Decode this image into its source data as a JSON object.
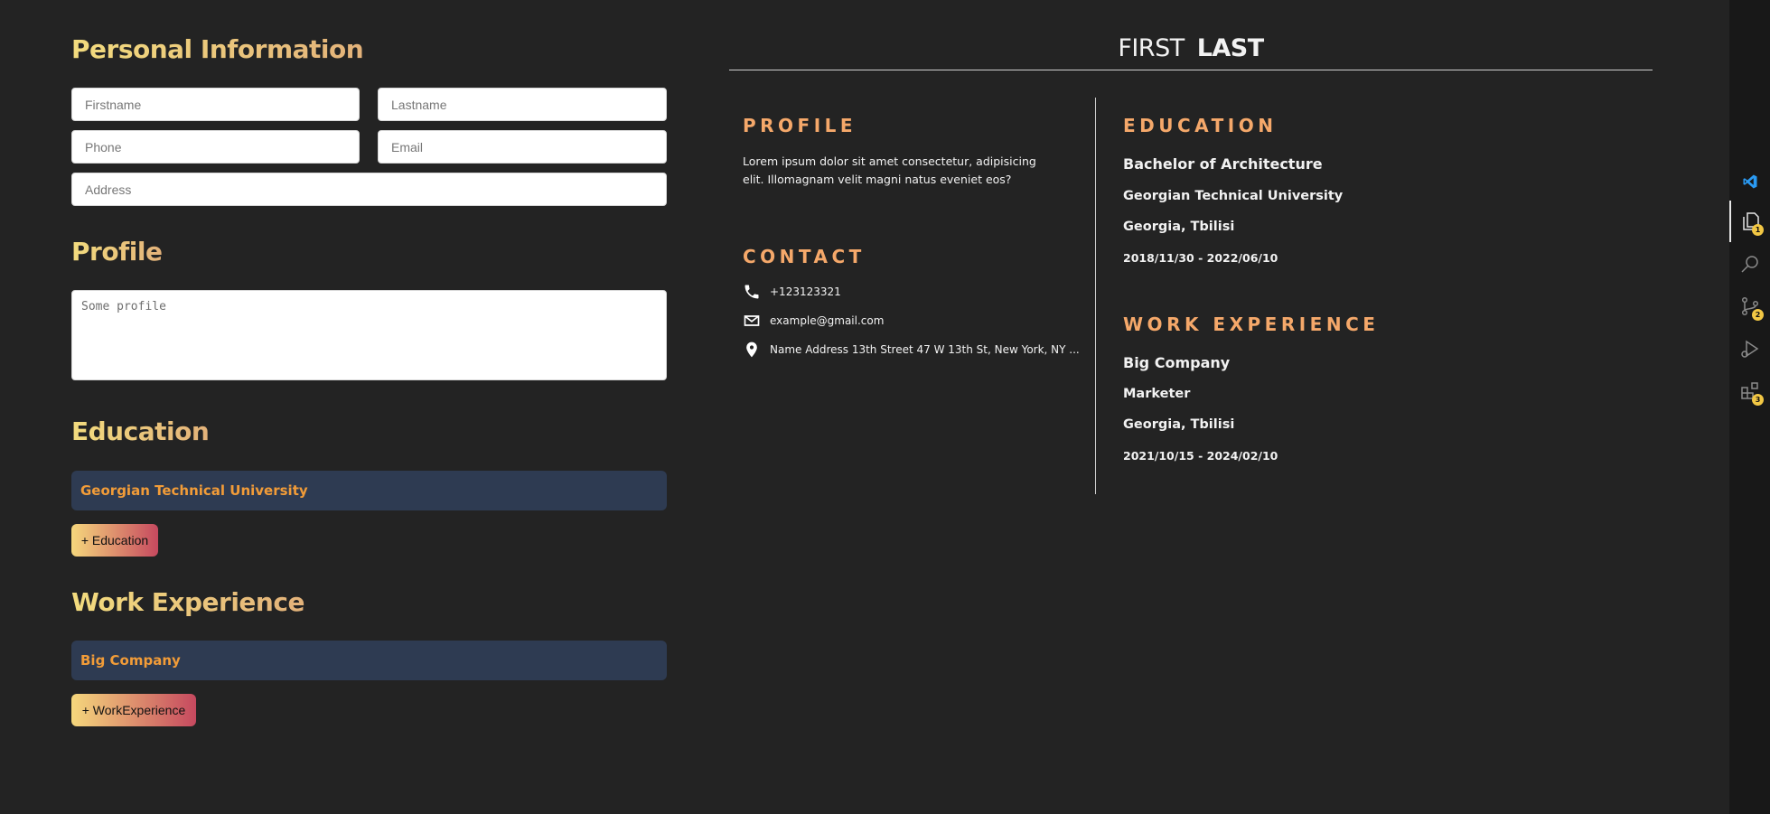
{
  "form": {
    "personal_title": "Personal Information",
    "firstname_placeholder": "Firstname",
    "lastname_placeholder": "Lastname",
    "phone_placeholder": "Phone",
    "email_placeholder": "Email",
    "address_placeholder": "Address",
    "profile_title": "Profile",
    "profile_placeholder": "Some profile",
    "education_title": "Education",
    "education_entries": [
      "Georgian Technical University"
    ],
    "add_education_label": "+ Education",
    "work_title": "Work Experience",
    "work_entries": [
      "Big Company"
    ],
    "add_work_label": "+ WorkExperience"
  },
  "resume": {
    "first_name": "FIRST",
    "last_name": "LAST",
    "profile_heading": "PROFILE",
    "profile_text": "Lorem ipsum dolor sit amet consectetur, adipisicing elit. Illomagnam velit magni natus eveniet eos?",
    "contact_heading": "CONTACT",
    "phone": "+123123321",
    "email": "example@gmail.com",
    "address": "Name Address 13th Street 47 W 13th St, New York, NY ...",
    "education_heading": "EDUCATION",
    "education": {
      "degree": "Bachelor of Architecture",
      "school": "Georgian Technical University",
      "location": "Georgia, Tbilisi",
      "start": "2018/11/30",
      "end": "2022/06/10"
    },
    "work_heading": "WORK EXPERIENCE",
    "work": {
      "company": "Big Company",
      "position": "Marketer",
      "location": "Georgia, Tbilisi",
      "start": "2021/10/15",
      "end": "2024/02/10"
    },
    "date_separator": "-"
  },
  "activity_bar": {
    "items": [
      {
        "icon": "explorer-icon",
        "badge": "1"
      },
      {
        "icon": "search-icon",
        "badge": ""
      },
      {
        "icon": "source-control-icon",
        "badge": "2"
      },
      {
        "icon": "run-debug-icon",
        "badge": ""
      },
      {
        "icon": "extensions-icon",
        "badge": "3"
      }
    ]
  },
  "colors": {
    "background": "#232323",
    "heading_gradient_start": "#f3dc7e",
    "heading_gradient_end": "#e3b27a",
    "resume_heading": "#f5a86a",
    "entry_bar": "#2e3b52",
    "entry_text": "#f29c38",
    "button_gradient_start": "#f5d77c",
    "button_gradient_end": "#c6495f",
    "badge": "#f2c744"
  }
}
